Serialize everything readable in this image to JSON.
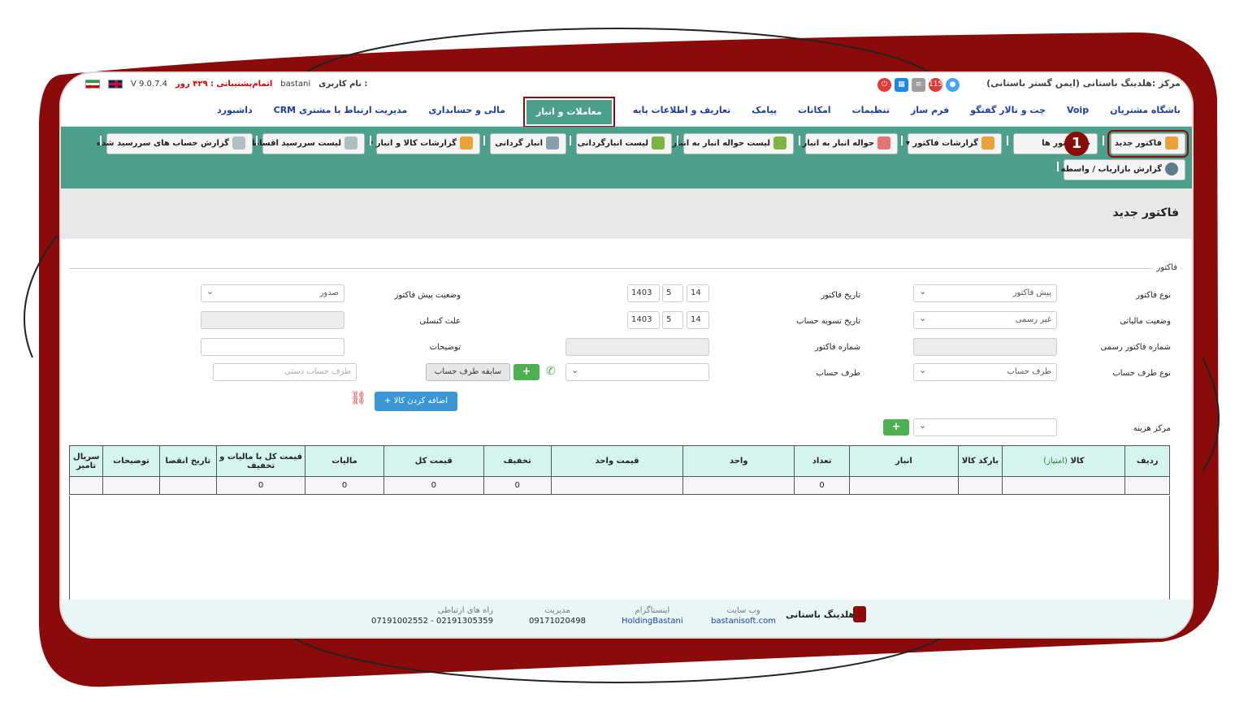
{
  "topbar": {
    "version": "V 9.0.7.4",
    "support_label": "اتمام‌پشتیبانی : ۴۲۹ روز",
    "user": "bastani",
    "user_label": "نام کاربری :",
    "org": "مرکز :هلدینگ باستانی (ایمن گستر باستانی)",
    "notif_count": "115"
  },
  "menu": [
    "داشبورد",
    "مدیریت ارتباط با مشتری CRM",
    "مالی و حسابداری",
    "معاملات و انبار",
    "تعاریف و اطلاعات پایه",
    "پیامک",
    "امکانات",
    "تنظیمات",
    "فرم ساز",
    "چت و تالار گفتگو",
    "Voip",
    "باشگاه مشتریان"
  ],
  "toolbar": {
    "new_invoice": "فاکتور جدید",
    "invoice_list": "ت فاکتور ها",
    "invoice_reports": "گزارشات فاکتور",
    "warehouse_transfer": "حواله انبار به انبار",
    "transfer_list": "لیست حواله انبار به انبار",
    "inventory_list": "لیست انبارگردانی",
    "inventory": "انبار گردانی",
    "goods_reports": "گزارشات کالا و انبار",
    "due_installments": "لیست سررسید اقساط",
    "due_accounts": "گزارش حساب های سررسید شده",
    "marketer_report": "گزارش بازاریاب / واسطه",
    "step": "1"
  },
  "page": {
    "title": "فاکتور جدید",
    "legend": "فاکتور"
  },
  "form": {
    "invoice_type_label": "نوع فاکتور",
    "invoice_type": "پیش فاکتور",
    "tax_status_label": "وضعیت مالیاتی",
    "tax_status": "غیر رسمی",
    "official_no_label": "شماره فاکتور رسمی",
    "party_type_label": "نوع طرف حساب",
    "party_type": "طرف حساب",
    "cost_center_label": "مرکز هزینه",
    "invoice_date_label": "تاریخ فاکتور",
    "settle_date_label": "تاریخ تسویه حساب",
    "invoice_no_label": "شماره فاکتور",
    "party_label": "طرف حساب",
    "day": "14",
    "month": "5",
    "year": "1403",
    "pre_status_label": "وضعیت پیش فاکتور",
    "pre_status": "صدور",
    "cancel_reason_label": "علت کنسلی",
    "notes_label": "توضیحات",
    "manual_party_ph": "طرف حساب دستی",
    "party_history": "سابقه طرف حساب",
    "add_goods": "+ اضافه کردن کالا",
    "plus": "+"
  },
  "table": {
    "headers": [
      "ردیف",
      "کالا",
      "(امتیاز)",
      "بارکد کالا",
      "انبار",
      "تعداد",
      "واحد",
      "قیمت واحد",
      "تخفیف",
      "قیمت کل",
      "مالیات",
      "قیمت کل با مالیات و تخفیف",
      "تاریخ انقضا",
      "توضیحات",
      "سریال تامیر"
    ],
    "totals": {
      "count": "0",
      "discount": "0",
      "total": "0",
      "tax": "0",
      "grand": "0"
    }
  },
  "footer": {
    "brand": "هلدینگ باستانی",
    "website_label": "وب سایت",
    "website": "bastanisoft.com",
    "instagram_label": "اینستاگرام",
    "instagram": "HoldingBastani",
    "mgmt_label": "مدیریت",
    "mgmt": "09171020498",
    "contact_label": "راه های ارتباطی",
    "contact": "07191002552 - 02191305359"
  },
  "colors": {
    "accent": "#4aa08a",
    "frame": "#8b0a0a",
    "header_bg": "#d5f4ef"
  }
}
